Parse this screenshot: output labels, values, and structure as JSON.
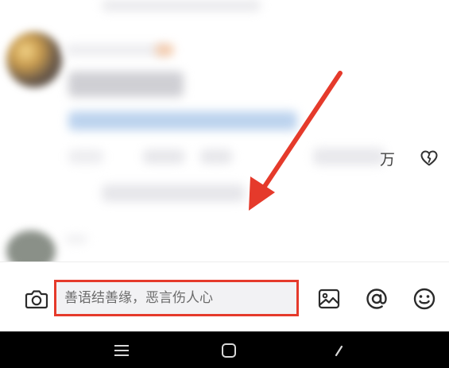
{
  "comment_composer": {
    "placeholder": "善语结善缘，恶言伤人心"
  },
  "comment_feed": {
    "partial_glyph": "万"
  },
  "icons": {
    "camera": "camera-icon",
    "image": "image-icon",
    "mention": "at-mention-icon",
    "emoji": "emoji-icon",
    "like": "heart-broken-icon",
    "nav_menu": "menu-icon",
    "nav_home": "home-icon",
    "nav_back": "back-icon"
  },
  "colors": {
    "highlight_red": "#e53a2b",
    "nav_background": "#000000",
    "input_background": "#f2f2f4"
  }
}
